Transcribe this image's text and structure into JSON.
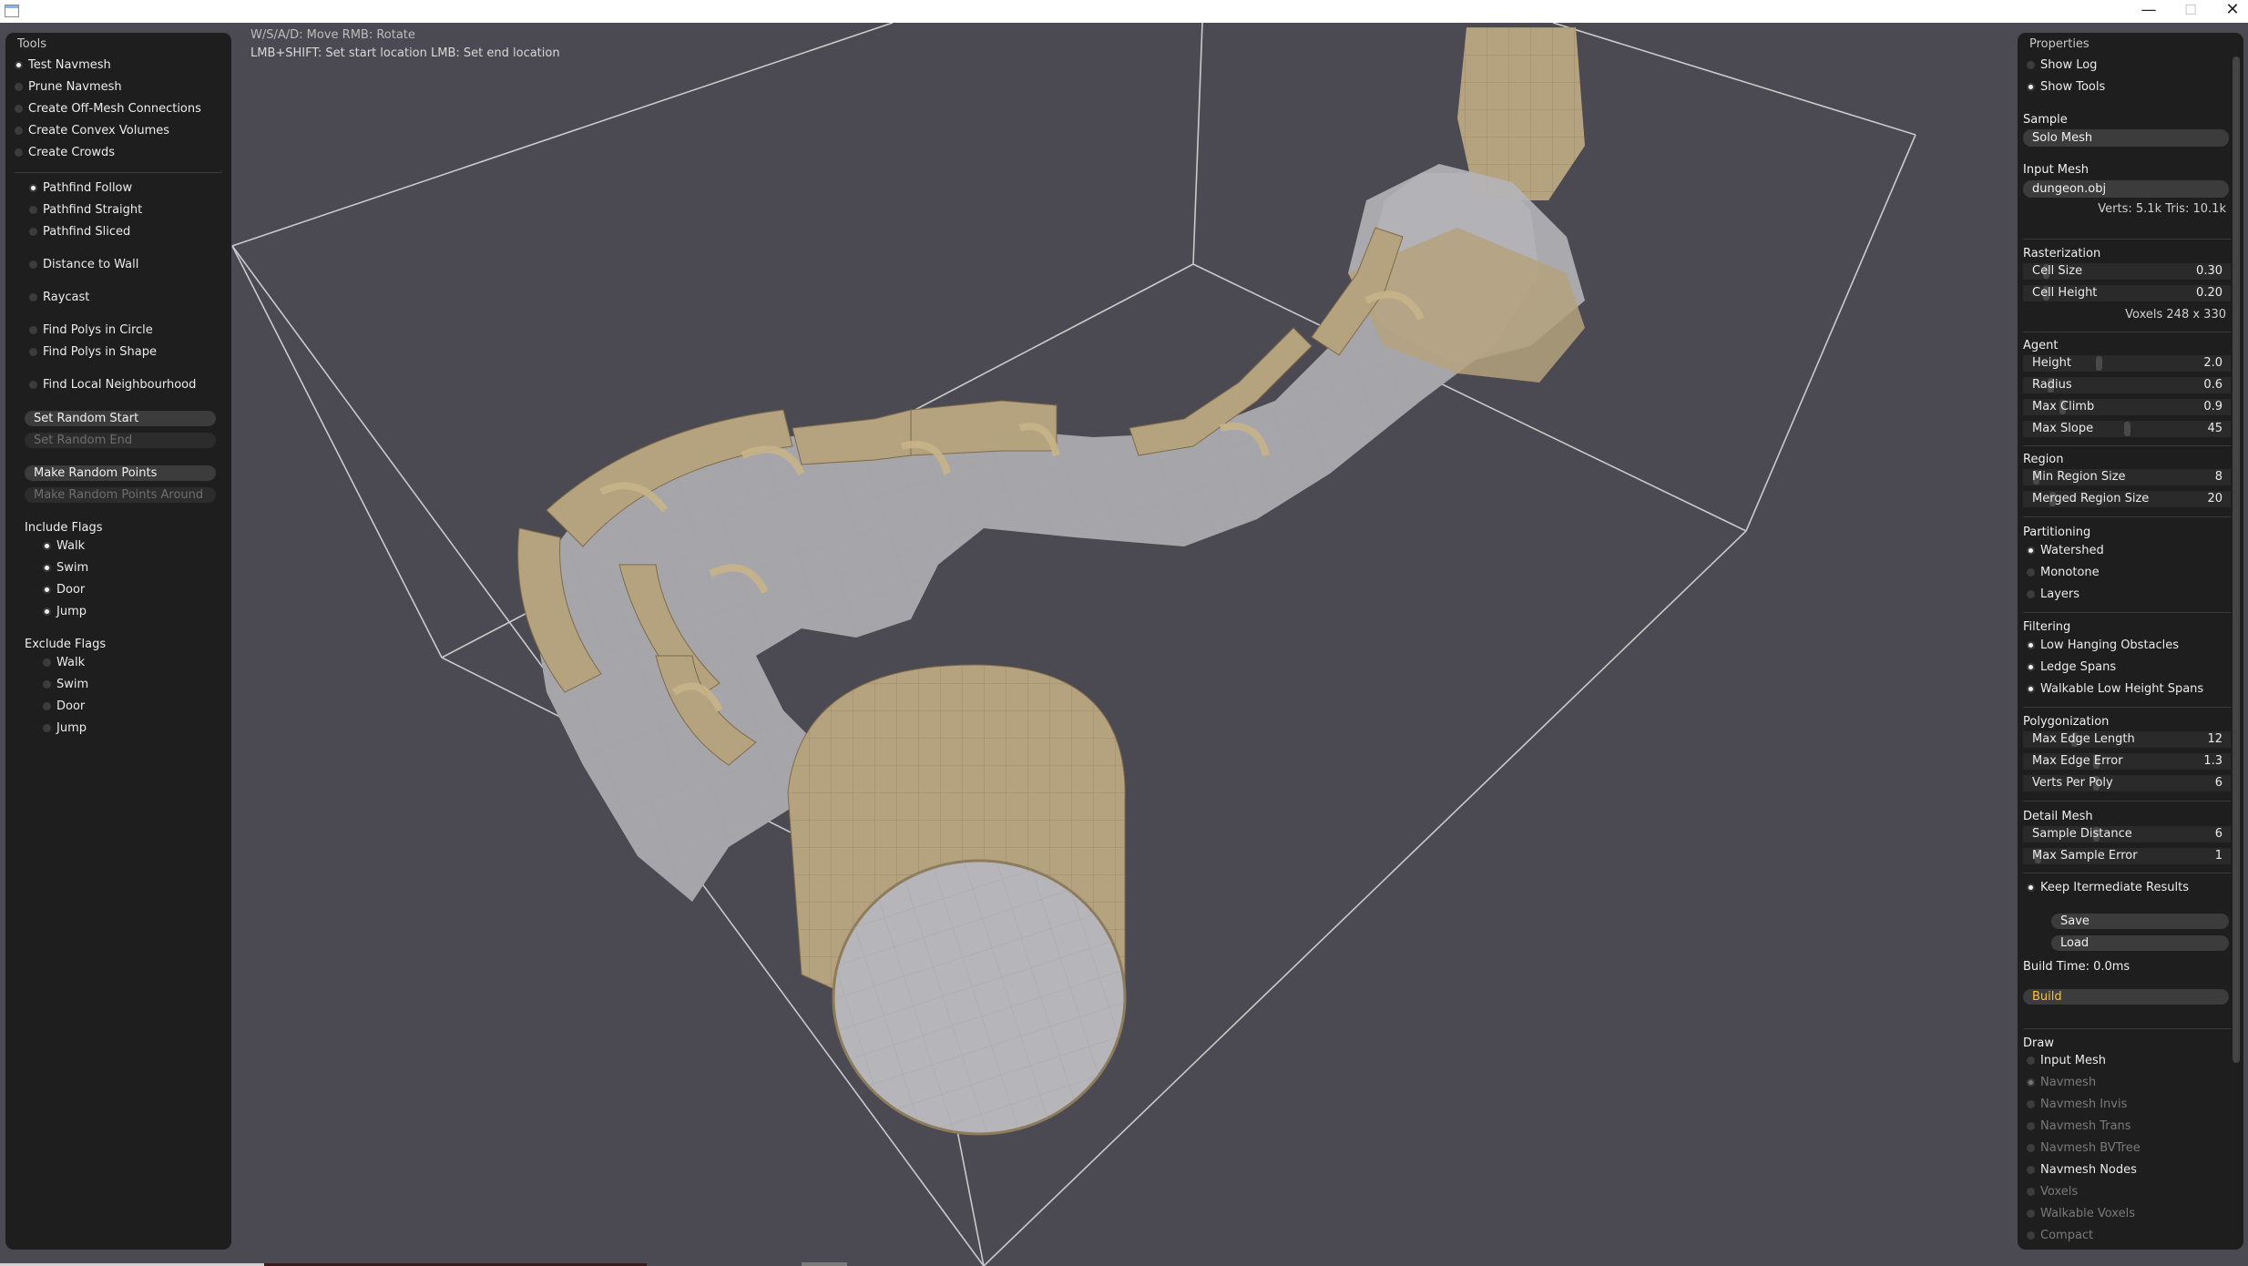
{
  "window": {
    "minimize": "—",
    "maximize": "☐",
    "close": "✕"
  },
  "hints": {
    "line1": "W/S/A/D: Move  RMB: Rotate",
    "line2": "LMB+SHIFT: Set start location  LMB: Set end location"
  },
  "tools": {
    "title": "Tools",
    "modes": [
      {
        "label": "Test Navmesh",
        "checked": true
      },
      {
        "label": "Prune Navmesh",
        "checked": false
      },
      {
        "label": "Create Off-Mesh Connections",
        "checked": false
      },
      {
        "label": "Create Convex Volumes",
        "checked": false
      },
      {
        "label": "Create Crowds",
        "checked": false
      }
    ],
    "tests": [
      {
        "label": "Pathfind Follow",
        "checked": true
      },
      {
        "label": "Pathfind Straight",
        "checked": false
      },
      {
        "label": "Pathfind Sliced",
        "checked": false
      },
      {
        "label": "Distance to Wall",
        "checked": false
      },
      {
        "label": "Raycast",
        "checked": false
      },
      {
        "label": "Find Polys in Circle",
        "checked": false
      },
      {
        "label": "Find Polys in Shape",
        "checked": false
      },
      {
        "label": "Find Local Neighbourhood",
        "checked": false
      }
    ],
    "buttons": {
      "set_random_start": "Set Random Start",
      "set_random_end": "Set Random End",
      "make_random_points": "Make Random Points",
      "make_random_points_around": "Make Random Points Around"
    },
    "include_flags_title": "Include Flags",
    "include_flags": [
      {
        "label": "Walk",
        "checked": true
      },
      {
        "label": "Swim",
        "checked": true
      },
      {
        "label": "Door",
        "checked": true
      },
      {
        "label": "Jump",
        "checked": true
      }
    ],
    "exclude_flags_title": "Exclude Flags",
    "exclude_flags": [
      {
        "label": "Walk",
        "checked": false
      },
      {
        "label": "Swim",
        "checked": false
      },
      {
        "label": "Door",
        "checked": false
      },
      {
        "label": "Jump",
        "checked": false
      }
    ]
  },
  "properties": {
    "title": "Properties",
    "show_log": "Show Log",
    "show_tools": "Show Tools",
    "sample_label": "Sample",
    "sample_value": "Solo Mesh",
    "input_mesh_label": "Input Mesh",
    "input_mesh_value": "dungeon.obj",
    "mesh_stats": "Verts: 5.1k  Tris: 10.1k",
    "rasterization": {
      "title": "Rasterization",
      "cell_size": {
        "label": "Cell Size",
        "value": "0.30",
        "level": 0.1
      },
      "cell_height": {
        "label": "Cell Height",
        "value": "0.20",
        "level": 0.1
      },
      "voxels": "Voxels  248 x 330"
    },
    "agent": {
      "title": "Agent",
      "height": {
        "label": "Height",
        "value": "2.0",
        "level": 0.36
      },
      "radius": {
        "label": "Radius",
        "value": "0.6",
        "level": 0.12
      },
      "max_climb": {
        "label": "Max Climb",
        "value": "0.9",
        "level": 0.18
      },
      "max_slope": {
        "label": "Max Slope",
        "value": "45",
        "level": 0.5
      }
    },
    "region": {
      "title": "Region",
      "min_region_size": {
        "label": "Min Region Size",
        "value": "8",
        "level": 0.05
      },
      "merged_region_size": {
        "label": "Merged Region Size",
        "value": "20",
        "level": 0.13
      }
    },
    "partitioning": {
      "title": "Partitioning",
      "options": [
        {
          "label": "Watershed",
          "checked": true
        },
        {
          "label": "Monotone",
          "checked": false
        },
        {
          "label": "Layers",
          "checked": false
        }
      ]
    },
    "filtering": {
      "title": "Filtering",
      "options": [
        {
          "label": "Low Hanging Obstacles",
          "checked": true
        },
        {
          "label": "Ledge Spans",
          "checked": true
        },
        {
          "label": "Walkable Low Height Spans",
          "checked": true
        }
      ]
    },
    "polygonization": {
      "title": "Polygonization",
      "max_edge_length": {
        "label": "Max Edge Length",
        "value": "12",
        "level": 0.24
      },
      "max_edge_error": {
        "label": "Max Edge Error",
        "value": "1.3",
        "level": 0.35
      },
      "verts_per_poly": {
        "label": "Verts Per Poly",
        "value": "6",
        "level": 0.35
      }
    },
    "detail_mesh": {
      "title": "Detail Mesh",
      "sample_distance": {
        "label": "Sample Distance",
        "value": "6",
        "level": 0.35
      },
      "max_sample_error": {
        "label": "Max Sample Error",
        "value": "1",
        "level": 0.06
      }
    },
    "keep_intermediate": {
      "label": "Keep Itermediate Results",
      "checked": true
    },
    "save_label": "Save",
    "load_label": "Load",
    "build_time": "Build Time: 0.0ms",
    "build_label": "Build",
    "draw": {
      "title": "Draw",
      "options": [
        {
          "label": "Input Mesh",
          "checked": false,
          "enabled": true
        },
        {
          "label": "Navmesh",
          "checked": true,
          "enabled": false
        },
        {
          "label": "Navmesh Invis",
          "checked": false,
          "enabled": false
        },
        {
          "label": "Navmesh Trans",
          "checked": false,
          "enabled": false
        },
        {
          "label": "Navmesh BVTree",
          "checked": false,
          "enabled": false
        },
        {
          "label": "Navmesh Nodes",
          "checked": false,
          "enabled": true
        },
        {
          "label": "Voxels",
          "checked": false,
          "enabled": false
        },
        {
          "label": "Walkable Voxels",
          "checked": false,
          "enabled": false
        },
        {
          "label": "Compact",
          "checked": false,
          "enabled": false
        }
      ]
    }
  }
}
